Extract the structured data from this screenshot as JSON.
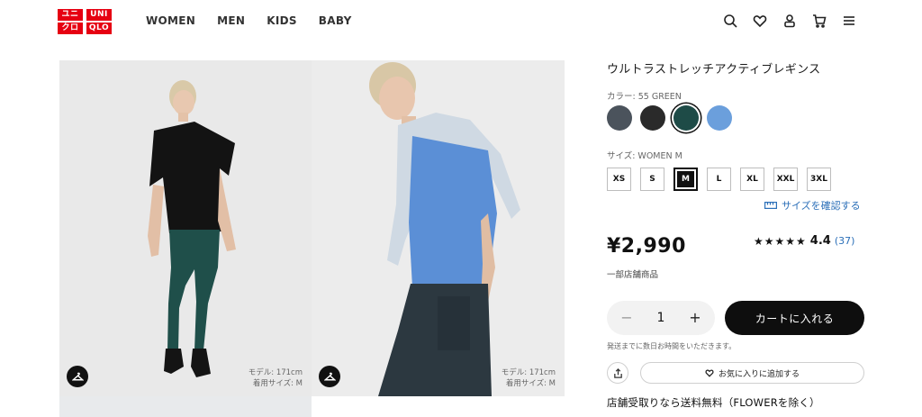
{
  "brand": {
    "logo_chars": [
      "ユニ",
      "UNI",
      "クロ",
      "QLO"
    ]
  },
  "nav": {
    "items": [
      "WOMEN",
      "MEN",
      "KIDS",
      "BABY"
    ]
  },
  "header_icons": [
    "search-icon",
    "heart-icon",
    "account-icon",
    "cart-icon",
    "menu-icon"
  ],
  "gallery": {
    "images": [
      {
        "model_height": "モデル: 171cm",
        "model_size": "着用サイズ: M"
      },
      {
        "model_height": "モデル: 171cm",
        "model_size": "着用サイズ: M"
      }
    ]
  },
  "product": {
    "title": "ウルトラストレッチアクティブレギンス",
    "color_label": "カラー: 55 GREEN",
    "colors": [
      {
        "name": "gray",
        "hex": "#4b535c"
      },
      {
        "name": "black",
        "hex": "#2a2a2a"
      },
      {
        "name": "green",
        "hex": "#1e4b47",
        "selected": true
      },
      {
        "name": "blue",
        "hex": "#6b9fdc"
      }
    ],
    "size_label": "サイズ: WOMEN M",
    "sizes": [
      "XS",
      "S",
      "M",
      "L",
      "XL",
      "XXL",
      "3XL"
    ],
    "selected_size": "M",
    "size_check_link": "サイズを確認する",
    "price": "¥2,990",
    "rating": {
      "stars": "★★★★★",
      "value": "4.4",
      "count": "(37)"
    },
    "store_only": "一部店舗商品",
    "quantity": "1",
    "minus": "−",
    "plus": "+",
    "add_to_cart": "カートに入れる",
    "shipping_note": "発送までに数日お時間をいただきます。",
    "favorite": "お気に入りに追加する",
    "free_shipping": "店舗受取りなら送料無料（FLOWERを除く）"
  }
}
